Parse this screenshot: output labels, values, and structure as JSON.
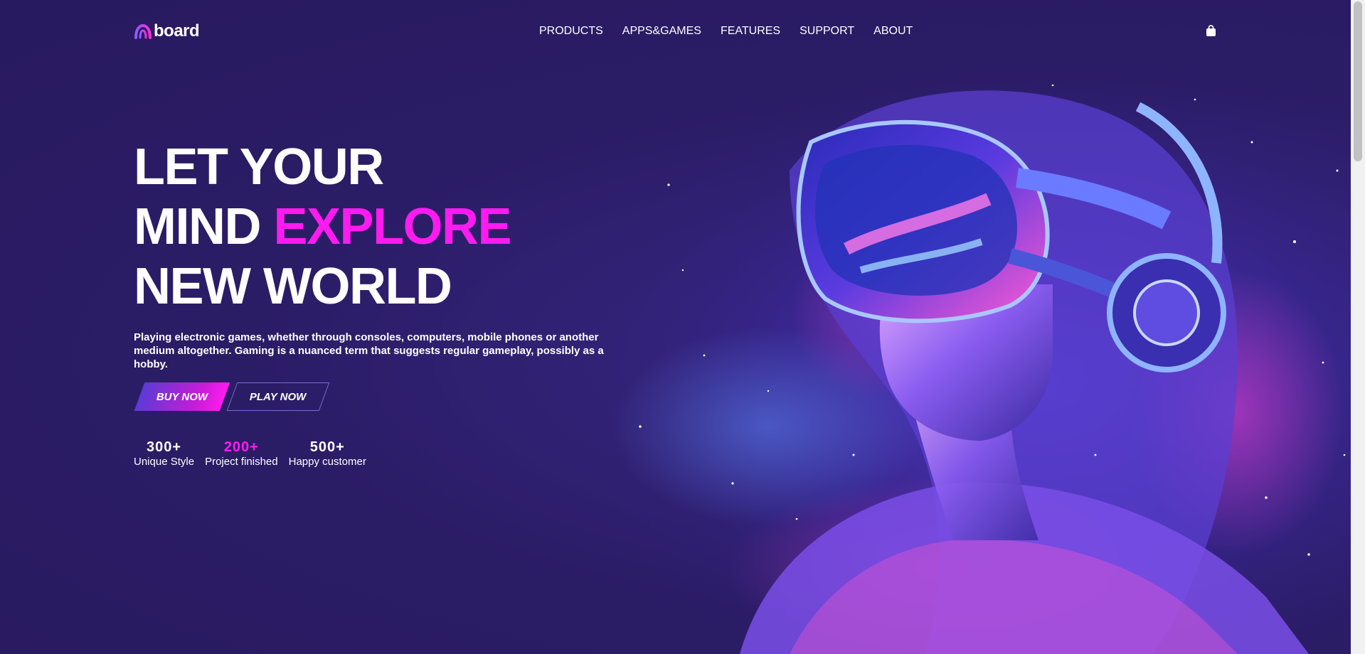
{
  "brand": {
    "logo_text": "board"
  },
  "nav": {
    "items": [
      "PRODUCTS",
      "APPS&GAMES",
      "FEATURES",
      "SUPPORT",
      "ABOUT"
    ]
  },
  "header": {
    "cart_icon": "shopping-bag-icon"
  },
  "hero": {
    "headline_line1": "LET YOUR",
    "headline_line2_start": "MIND",
    "headline_line2_accent": "EXPLORE",
    "headline_line3": "NEW WORLD",
    "description": "Playing electronic games, whether through consoles, computers, mobile phones or another medium altogether. Gaming is a nuanced term that suggests regular gameplay, possibly as a hobby.",
    "buy_label": "BUY NOW",
    "play_label": "PLAY NOW"
  },
  "stats": [
    {
      "value": "300+",
      "label": "Unique Style"
    },
    {
      "value": "200+",
      "label": "Project finished"
    },
    {
      "value": "500+",
      "label": "Happy customer"
    }
  ],
  "colors": {
    "background": "#2b1c66",
    "accent": "#ff1bf0",
    "button_gradient_start": "#5b3bd6"
  }
}
